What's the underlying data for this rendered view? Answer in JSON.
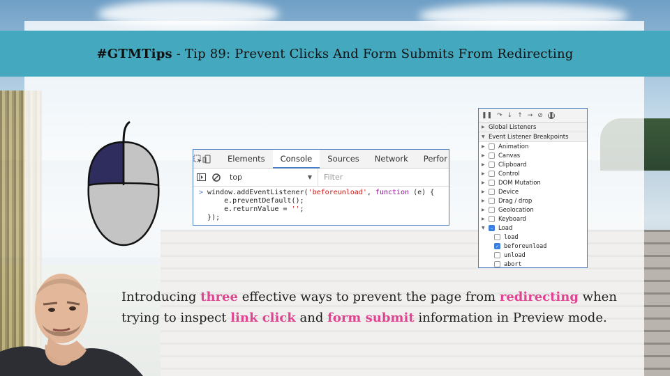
{
  "banner": {
    "prefix": "#GTMTips",
    "rest": " - Tip 89: Prevent Clicks And Form Submits From Redirecting"
  },
  "console": {
    "tabs": [
      "Elements",
      "Console",
      "Sources",
      "Network",
      "Perfor"
    ],
    "active_tab": "Console",
    "context": "top",
    "filter_placeholder": "Filter",
    "code": {
      "line1_a": "window.addEventListener(",
      "line1_str": "'beforeunload'",
      "line1_b": ", ",
      "line1_kw": "function",
      "line1_c": " (e) {",
      "line2": "    e.preventDefault();",
      "line3_a": "    e.returnValue = ",
      "line3_str": "''",
      "line3_b": ";",
      "line4": "});"
    }
  },
  "breakpoints": {
    "global_listeners": "Global Listeners",
    "header": "Event Listener Breakpoints",
    "categories": [
      "Animation",
      "Canvas",
      "Clipboard",
      "Control",
      "DOM Mutation",
      "Device",
      "Drag / drop",
      "Geolocation",
      "Keyboard"
    ],
    "load_label": "Load",
    "load_items": [
      {
        "label": "load",
        "checked": false
      },
      {
        "label": "beforeunload",
        "checked": true
      },
      {
        "label": "unload",
        "checked": false
      },
      {
        "label": "abort",
        "checked": false
      }
    ]
  },
  "description": {
    "p1": "Introducing ",
    "h1": "three",
    "p2": " effective ways to prevent the page from ",
    "h2": "redirecting",
    "p3": " when trying to inspect ",
    "h3": "link click",
    "p4": " and ",
    "h4": "form submit",
    "p5": " information in Preview mode."
  },
  "colors": {
    "banner": "#44a8bf",
    "highlight": "#e0438f",
    "mouse_left_button": "#2f2d5e",
    "mouse_body": "#c4c4c4"
  }
}
